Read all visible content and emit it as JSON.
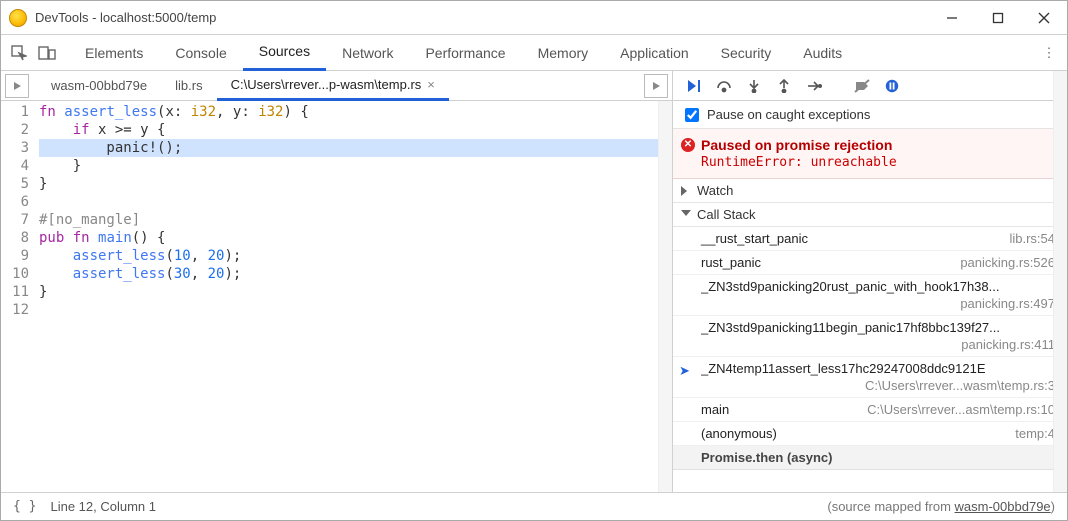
{
  "window": {
    "title": "DevTools - localhost:5000/temp"
  },
  "mainTabs": {
    "items": [
      "Elements",
      "Console",
      "Sources",
      "Network",
      "Performance",
      "Memory",
      "Application",
      "Security",
      "Audits"
    ],
    "active": "Sources"
  },
  "fileTabs": {
    "items": [
      {
        "label": "wasm-00bbd79e",
        "closable": false
      },
      {
        "label": "lib.rs",
        "closable": false
      },
      {
        "label": "C:\\Users\\rrever...p-wasm\\temp.rs",
        "closable": true
      }
    ],
    "activeIndex": 2
  },
  "code": {
    "lines": [
      "fn assert_less(x: i32, y: i32) {",
      "    if x >= y {",
      "        panic!();",
      "    }",
      "}",
      "",
      "#[no_mangle]",
      "pub fn main() {",
      "    assert_less(10, 20);",
      "    assert_less(30, 20);",
      "}",
      ""
    ],
    "highlighted": 3,
    "cursor": {
      "line": 12,
      "col": 1
    }
  },
  "debugger": {
    "pauseOnCaught": {
      "label": "Pause on caught exceptions",
      "checked": true
    },
    "paused": {
      "title": "Paused on promise rejection",
      "message": "RuntimeError: unreachable"
    },
    "watchLabel": "Watch",
    "callStackLabel": "Call Stack",
    "frames": [
      {
        "name": "__rust_start_panic",
        "loc": "lib.rs:54"
      },
      {
        "name": "rust_panic",
        "loc": "panicking.rs:526"
      },
      {
        "name": "_ZN3std9panicking20rust_panic_with_hook17h38...",
        "loc2": "panicking.rs:497",
        "two": true
      },
      {
        "name": "_ZN3std9panicking11begin_panic17hf8bbc139f27...",
        "loc2": "panicking.rs:411",
        "two": true
      },
      {
        "name": "_ZN4temp11assert_less17hc29247008ddc9121E",
        "loc2": "C:\\Users\\rrever...wasm\\temp.rs:3",
        "two": true,
        "current": true
      },
      {
        "name": "main",
        "loc": "C:\\Users\\rrever...asm\\temp.rs:10"
      },
      {
        "name": "(anonymous)",
        "loc": "temp:4"
      }
    ],
    "asyncHeader": "Promise.then (async)"
  },
  "status": {
    "cursor": "Line 12, Column 1",
    "mappedPrefix": "(source mapped from ",
    "mappedFile": "wasm-00bbd79e",
    "mappedSuffix": ")"
  }
}
